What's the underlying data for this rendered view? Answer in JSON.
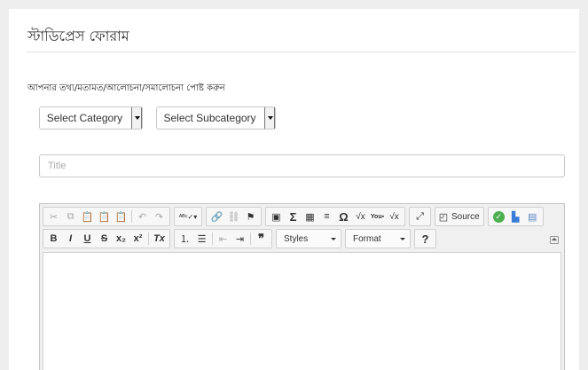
{
  "page": {
    "title": "স্টাডিপ্রেস ফোরাম",
    "instruction": "আপনার তথ্য/মতামত/আলোচনা/সমালোচনা পোষ্ট করুন"
  },
  "form": {
    "category": {
      "selected": "Select Category"
    },
    "subcategory": {
      "selected": "Select Subcategory"
    },
    "title_input": {
      "placeholder": "Title",
      "value": ""
    }
  },
  "editor": {
    "toolbar1": {
      "clipboard": [
        "cut-icon",
        "copy-icon",
        "paste-icon",
        "paste-text-icon",
        "paste-word-icon"
      ],
      "undo_redo": [
        "undo-icon",
        "redo-icon"
      ],
      "spellcheck_icon": "spellcheck-icon",
      "links": [
        "link-icon",
        "unlink-icon",
        "anchor-icon"
      ],
      "insert": {
        "image": "image-icon",
        "math_symbol": "Σ",
        "table": "table-icon",
        "hr": "horizontal-rule-icon",
        "special_char": "Ω",
        "sqrt": "√x",
        "youtube": "youtube-icon",
        "equation": "√x"
      },
      "maximize_icon": "maximize-icon",
      "source_label": "Source",
      "extra": [
        "check-icon",
        "image-editor-icon",
        "save-icon"
      ]
    },
    "toolbar2": {
      "basic": [
        "B",
        "I",
        "U",
        "S",
        "x₂",
        "x²"
      ],
      "remove_format": "Tx",
      "lists": [
        "numbered-list-icon",
        "bulleted-list-icon"
      ],
      "indent": [
        "outdent-icon",
        "indent-icon"
      ],
      "blockquote": "❞",
      "styles_label": "Styles",
      "format_label": "Format",
      "help": "?"
    }
  },
  "colors": {
    "background": "#eeeeee",
    "panel": "#ffffff",
    "border": "#c8c8c8",
    "editor_bar": "#f0f0f0"
  }
}
